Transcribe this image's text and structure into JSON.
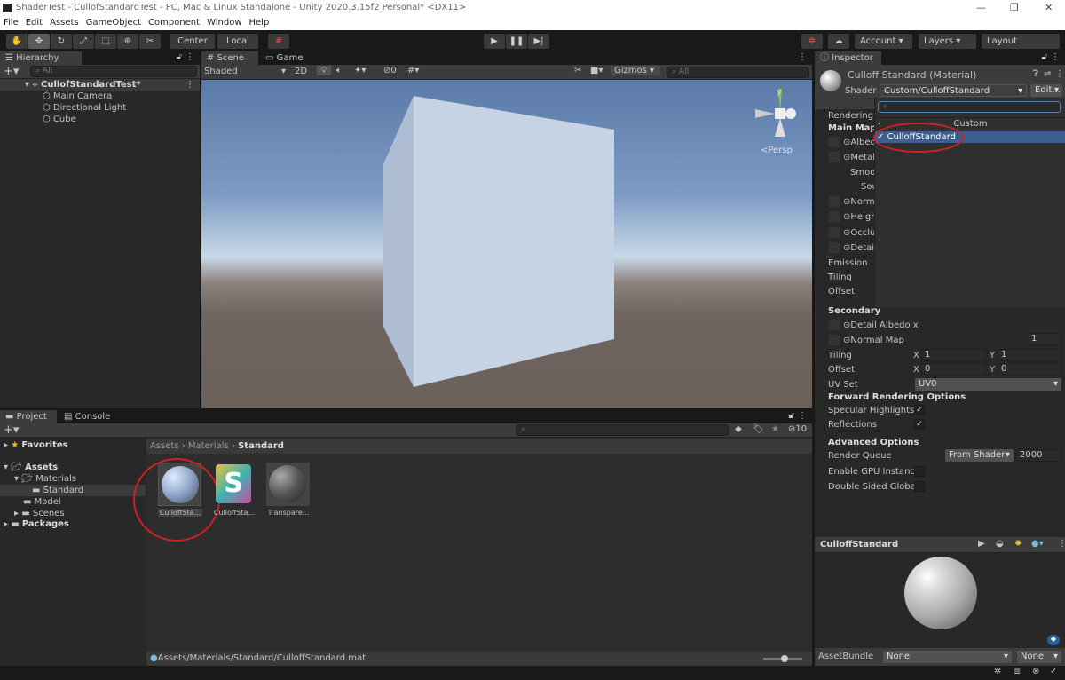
{
  "window": {
    "title": "ShaderTest - CullofStandardTest - PC, Mac & Linux Standalone - Unity 2020.3.15f2 Personal* <DX11>"
  },
  "menu": [
    "File",
    "Edit",
    "Assets",
    "GameObject",
    "Component",
    "Window",
    "Help"
  ],
  "toolbar": {
    "center": "Center",
    "local": "Local",
    "account": "Account",
    "layers": "Layers",
    "layout": "Layout"
  },
  "hierarchy": {
    "tab": "Hierarchy",
    "search_placeholder": "All",
    "scene": "CullofStandardTest*",
    "items": [
      "Main Camera",
      "Directional Light",
      "Cube"
    ]
  },
  "scene_view": {
    "tabs": [
      "Scene",
      "Game"
    ],
    "shading": "Shaded",
    "mode_2d": "2D",
    "hidden_count": "0",
    "gizmos": "Gizmos",
    "search_placeholder": "All",
    "projection": "<Persp",
    "axis_y": "y"
  },
  "inspector": {
    "tab": "Inspector",
    "material_title": "Culloff Standard (Material)",
    "shader_label": "Shader",
    "shader_value": "Custom/CulloffStandard",
    "edit_button": "Edit...",
    "dropdown": {
      "header": "Custom",
      "items": [
        {
          "label": "CulloffStandard",
          "checked": true
        }
      ]
    },
    "left_labels": [
      "Rendering",
      "Main Maps",
      "Albedo",
      "Metal",
      "Smoo",
      "Sou",
      "Norma",
      "Heigh",
      "Occlu",
      "Detail",
      "Emission",
      "Tiling",
      "Offset"
    ],
    "secondary": {
      "title": "Secondary",
      "detail_albedo": "Detail Albedo x",
      "normal_map": "Normal Map",
      "normal_value": "1",
      "tiling": "Tiling",
      "offset": "Offset",
      "tiling_x": "1",
      "tiling_y": "1",
      "offset_x": "0",
      "offset_y": "0",
      "x": "X",
      "y": "Y",
      "uv_set_label": "UV Set",
      "uv_set": "UV0"
    },
    "forward": {
      "title": "Forward Rendering Options",
      "specular": "Specular Highlights",
      "specular_on": true,
      "reflections": "Reflections",
      "reflections_on": true
    },
    "advanced": {
      "title": "Advanced Options",
      "render_queue": "Render Queue",
      "queue_mode": "From Shader",
      "queue_value": "2000",
      "gpu_instancing": "Enable GPU Instanci",
      "double_sided": "Double Sided Global"
    },
    "preview_title": "CulloffStandard",
    "asset_bundle": {
      "label": "AssetBundle",
      "name": "None",
      "variant": "None"
    }
  },
  "project": {
    "tabs": [
      "Project",
      "Console"
    ],
    "hidden_count": "10",
    "tree": [
      {
        "label": "Favorites",
        "bold": true
      },
      {
        "label": "Assets",
        "bold": true
      },
      {
        "label": "Materials"
      },
      {
        "label": "Standard",
        "selected": true
      },
      {
        "label": "Model"
      },
      {
        "label": "Scenes"
      },
      {
        "label": "Packages",
        "bold": true
      }
    ],
    "breadcrumb": [
      "Assets",
      "Materials",
      "Standard"
    ],
    "assets": [
      {
        "label": "CulloffSta...",
        "type": "material"
      },
      {
        "label": "CulloffSta...",
        "type": "shader"
      },
      {
        "label": "Transpare...",
        "type": "material"
      }
    ],
    "path": "Assets/Materials/Standard/CulloffStandard.mat"
  },
  "colors": {
    "accent_selection": "#3d5f8f",
    "annotation_red": "#cc2222",
    "panel": "#282828"
  }
}
